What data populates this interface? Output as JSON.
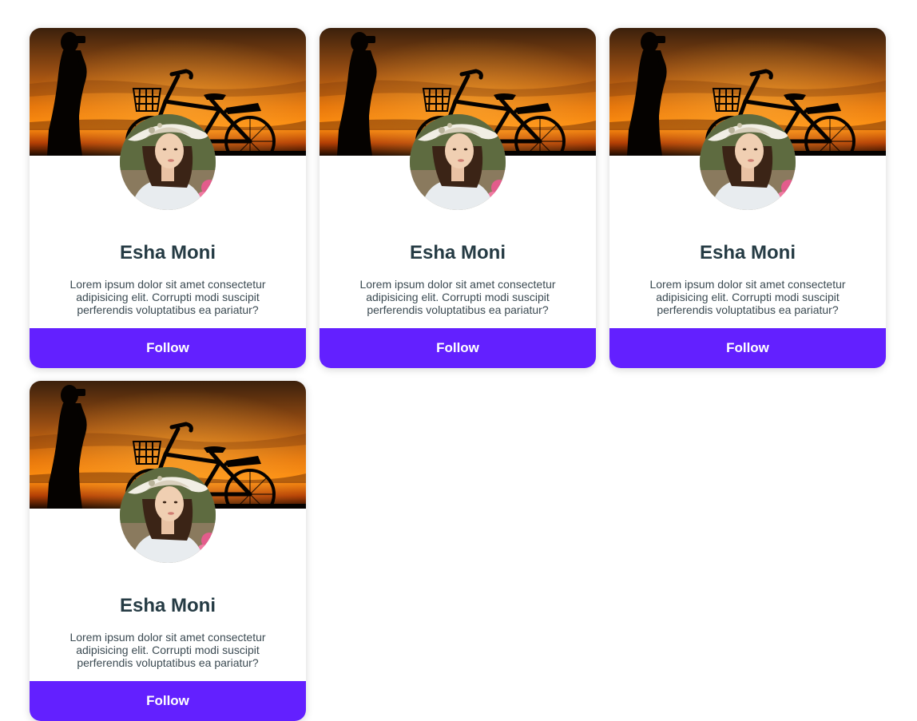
{
  "colors": {
    "accent": "#6320ff",
    "name_text": "#253b44",
    "body_text": "#3b4a52"
  },
  "cards": [
    {
      "name": "Esha Moni",
      "description": "Lorem ipsum dolor sit amet consectetur adipisicing elit. Corrupti modi suscipit perferendis voluptatibus ea pariatur?",
      "follow_label": "Follow"
    },
    {
      "name": "Esha Moni",
      "description": "Lorem ipsum dolor sit amet consectetur adipisicing elit. Corrupti modi suscipit perferendis voluptatibus ea pariatur?",
      "follow_label": "Follow"
    },
    {
      "name": "Esha Moni",
      "description": "Lorem ipsum dolor sit amet consectetur adipisicing elit. Corrupti modi suscipit perferendis voluptatibus ea pariatur?",
      "follow_label": "Follow"
    },
    {
      "name": "Esha Moni",
      "description": "Lorem ipsum dolor sit amet consectetur adipisicing elit. Corrupti modi suscipit perferendis voluptatibus ea pariatur?",
      "follow_label": "Follow"
    }
  ]
}
